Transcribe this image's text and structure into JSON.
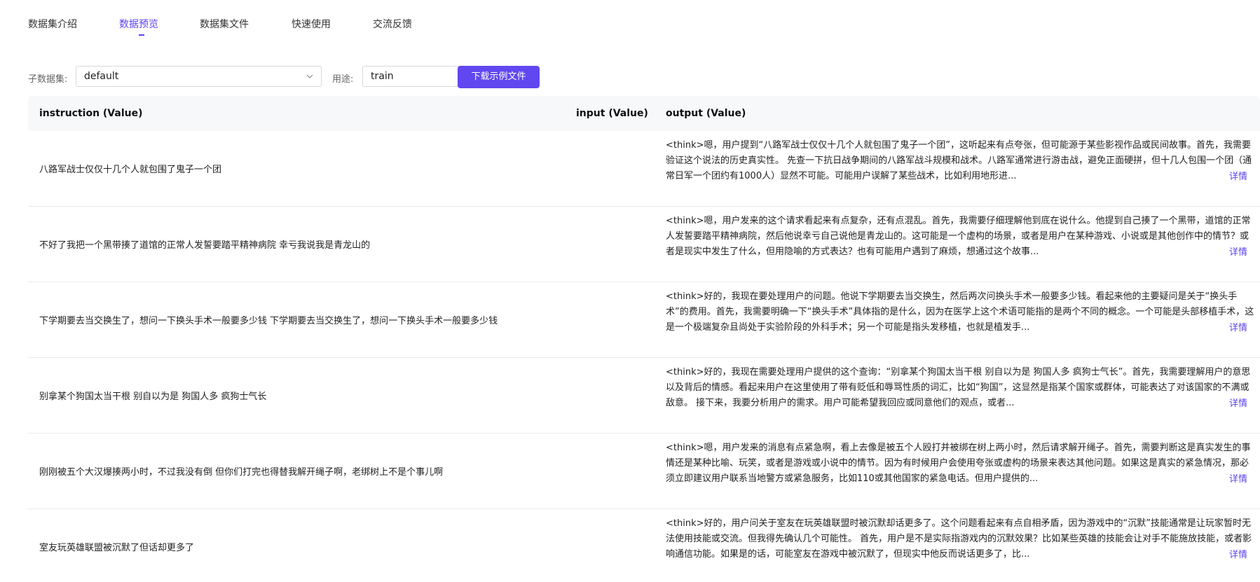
{
  "tabs": [
    {
      "label": "数据集介绍",
      "active": false
    },
    {
      "label": "数据预览",
      "active": true
    },
    {
      "label": "数据集文件",
      "active": false
    },
    {
      "label": "快速使用",
      "active": false
    },
    {
      "label": "交流反馈",
      "active": false
    }
  ],
  "filters": {
    "subset_label": "子数据集:",
    "subset_value": "default",
    "usage_label": "用途:",
    "usage_value": "train",
    "download_label": "下载示例文件"
  },
  "table": {
    "headers": [
      "instruction (Value)",
      "input (Value)",
      "output (Value)"
    ],
    "detail_label": "详情",
    "rows": [
      {
        "instruction": "八路军战士仅仅十几个人就包围了鬼子一个团",
        "input": "",
        "output": "<think>嗯，用户提到“八路军战士仅仅十几个人就包围了鬼子一个团”，这听起来有点夸张，但可能源于某些影视作品或民间故事。首先，我需要验证这个说法的历史真实性。 先查一下抗日战争期间的八路军战斗规模和战术。八路军通常进行游击战，避免正面硬拼，但十几人包围一个团（通常日军一个团约有1000人）显然不可能。可能用户误解了某些战术，比如利用地形进..."
      },
      {
        "instruction": "不好了我把一个黑带揍了道馆的正常人发誓要踏平精神病院 幸亏我说我是青龙山的",
        "input": "",
        "output": "<think>嗯，用户发来的这个请求看起来有点复杂，还有点混乱。首先，我需要仔细理解他到底在说什么。他提到自己揍了一个黑带，道馆的正常人发誓要踏平精神病院，然后他说幸亏自己说他是青龙山的。这可能是一个虚构的场景，或者是用户在某种游戏、小说或是其他创作中的情节？或者是现实中发生了什么，但用隐喻的方式表达？也有可能用户遇到了麻烦，想通过这个故事..."
      },
      {
        "instruction": "下学期要去当交换生了，想问一下换头手术一般要多少钱 下学期要去当交换生了，想问一下换头手术一般要多少钱",
        "input": "",
        "output": "<think>好的，我现在要处理用户的问题。他说下学期要去当交换生，然后两次问换头手术一般要多少钱。看起来他的主要疑问是关于“换头手术”的费用。首先，我需要明确一下“换头手术”具体指的是什么，因为在医学上这个术语可能指的是两个不同的概念。一个可能是头部移植手术，这是一个极端复杂且尚处于实验阶段的外科手术；另一个可能是指头发移植，也就是植发手..."
      },
      {
        "instruction": "别拿某个狗国太当干根 别自以为是 狗国人多 疯狗士气长",
        "input": "",
        "output": "<think>好的，我现在需要处理用户提供的这个查询：“别拿某个狗国太当干根 别自以为是 狗国人多 疯狗士气长”。首先，我需要理解用户的意思以及背后的情感。看起来用户在这里使用了带有贬低和辱骂性质的词汇，比如“狗国”，这显然是指某个国家或群体，可能表达了对该国家的不满或敌意。 接下来，我要分析用户的需求。用户可能希望我回应或同意他们的观点，或者..."
      },
      {
        "instruction": "刚刚被五个大汉爆揍两小时，不过我没有倒 但你们打完也得替我解开绳子啊，老绑树上不是个事儿啊",
        "input": "",
        "output": "<think>嗯，用户发来的消息有点紧急啊，看上去像是被五个人殴打并被绑在树上两小时，然后请求解开绳子。首先，需要判断这是真实发生的事情还是某种比喻、玩笑，或者是游戏或小说中的情节。因为有时候用户会使用夸张或虚构的场景来表达其他问题。如果这是真实的紧急情况，那必须立即建议用户联系当地警方或紧急服务，比如110或其他国家的紧急电话。但用户提供的..."
      },
      {
        "instruction": "室友玩英雄联盟被沉默了但话却更多了",
        "input": "",
        "output": "<think>好的，用户问关于室友在玩英雄联盟时被沉默却话更多了。这个问题看起来有点自相矛盾，因为游戏中的“沉默”技能通常是让玩家暂时无法使用技能或交流。但我得先确认几个可能性。 首先，用户是不是实际指游戏内的沉默效果？比如某些英雄的技能会让对手不能施放技能，或者影响通信功能。如果是的话，可能室友在游戏中被沉默了，但现实中他反而说话更多了，比..."
      }
    ]
  }
}
